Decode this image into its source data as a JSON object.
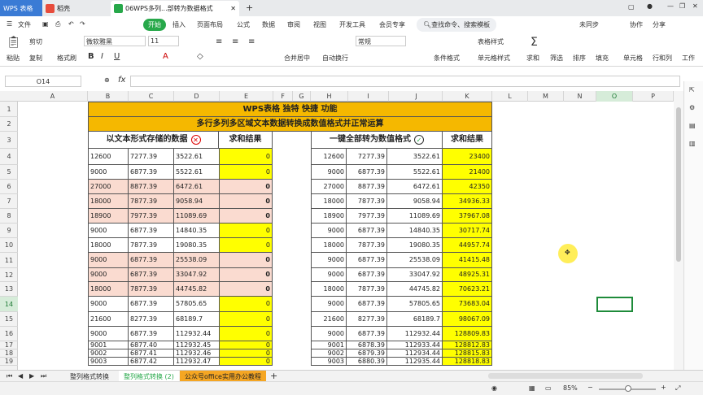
{
  "tabs": {
    "wps": "WPS 表格",
    "daoke": "稻壳",
    "doc": "06WPS多列...部转为数据格式"
  },
  "titlebar": {
    "unsync": "未同步",
    "share": "分享",
    "collab": "协作"
  },
  "menu": {
    "file": "文件",
    "start": "开始",
    "insert": "插入",
    "layout": "页面布局",
    "formula": "公式",
    "data": "数据",
    "review": "审阅",
    "view": "视图",
    "dev": "开发工具",
    "member": "会员专享",
    "search": "查找命令、搜索模板"
  },
  "ribbon": {
    "cut": "剪切",
    "copy": "复制",
    "format_painter": "格式刷",
    "paste": "粘贴",
    "font": "微软雅黑",
    "size": "11",
    "merge": "合并居中",
    "wrap": "自动换行",
    "numfmt": "常规",
    "cond": "条件格式",
    "table_style": "表格样式",
    "cell_style": "单元格样式",
    "sum": "求和",
    "filter": "筛选",
    "sort": "排序",
    "fill": "填充",
    "cell": "单元格",
    "rowcol": "行和列",
    "sheet": "工作"
  },
  "formula": {
    "namebox": "O14",
    "fx": "fx"
  },
  "columns": [
    "A",
    "B",
    "C",
    "D",
    "E",
    "F",
    "G",
    "H",
    "I",
    "J",
    "K",
    "L",
    "M",
    "N",
    "O",
    "P"
  ],
  "rows": [
    "1",
    "2",
    "3",
    "4",
    "5",
    "6",
    "7",
    "8",
    "9",
    "10",
    "11",
    "12",
    "13",
    "14",
    "15",
    "16",
    "17",
    "18",
    "19"
  ],
  "sheet": {
    "title1": "WPS表格 独特 快捷 功能",
    "title2": "多行多列多区域文本数据转换成数值格式并正常运算",
    "left_header": "以文本形式存储的数据",
    "sum_header": "求和结果",
    "right_header": "一键全部转为数值格式",
    "sum_header2": "求和结果",
    "left": [
      [
        "12600",
        "7277.39",
        "3522.61",
        "0"
      ],
      [
        "9000",
        "6877.39",
        "5522.61",
        "0"
      ],
      [
        "27000",
        "8877.39",
        "6472.61",
        "0"
      ],
      [
        "18000",
        "7877.39",
        "9058.94",
        "0"
      ],
      [
        "18900",
        "7977.39",
        "11089.69",
        "0"
      ],
      [
        "9000",
        "6877.39",
        "14840.35",
        "0"
      ],
      [
        "18000",
        "7877.39",
        "19080.35",
        "0"
      ],
      [
        "9000",
        "6877.39",
        "25538.09",
        "0"
      ],
      [
        "9000",
        "6877.39",
        "33047.92",
        "0"
      ],
      [
        "18000",
        "7877.39",
        "44745.82",
        "0"
      ],
      [
        "9000",
        "6877.39",
        "57805.65",
        "0"
      ],
      [
        "21600",
        "8277.39",
        "68189.7",
        "0"
      ],
      [
        "9000",
        "6877.39",
        "112932.44",
        "0"
      ],
      [
        "9001",
        "6877.40",
        "112932.45",
        "0"
      ],
      [
        "9002",
        "6877.41",
        "112932.46",
        "0"
      ],
      [
        "9003",
        "6877.42",
        "112932.47",
        "0"
      ]
    ],
    "right": [
      [
        "12600",
        "7277.39",
        "3522.61",
        "23400"
      ],
      [
        "9000",
        "6877.39",
        "5522.61",
        "21400"
      ],
      [
        "27000",
        "8877.39",
        "6472.61",
        "42350"
      ],
      [
        "18000",
        "7877.39",
        "9058.94",
        "34936.33"
      ],
      [
        "18900",
        "7977.39",
        "11089.69",
        "37967.08"
      ],
      [
        "9000",
        "6877.39",
        "14840.35",
        "30717.74"
      ],
      [
        "18000",
        "7877.39",
        "19080.35",
        "44957.74"
      ],
      [
        "9000",
        "6877.39",
        "25538.09",
        "41415.48"
      ],
      [
        "9000",
        "6877.39",
        "33047.92",
        "48925.31"
      ],
      [
        "18000",
        "7877.39",
        "44745.82",
        "70623.21"
      ],
      [
        "9000",
        "6877.39",
        "57805.65",
        "73683.04"
      ],
      [
        "21600",
        "8277.39",
        "68189.7",
        "98067.09"
      ],
      [
        "9000",
        "6877.39",
        "112932.44",
        "128809.83"
      ],
      [
        "9001",
        "6878.39",
        "112933.44",
        "128812.83"
      ],
      [
        "9002",
        "6879.39",
        "112934.44",
        "128815.83"
      ],
      [
        "9003",
        "6880.39",
        "112935.44",
        "128818.83"
      ]
    ]
  },
  "sheet_tabs": [
    "整列格式转换",
    "整列格式转换 (2)",
    "公众号office实用办公教程"
  ],
  "status": {
    "zoom": "85%"
  },
  "colors": {
    "orange": "#f5b800",
    "yellow": "#ffff00",
    "pink": "#fadbd0",
    "accent": "#27a84a"
  }
}
